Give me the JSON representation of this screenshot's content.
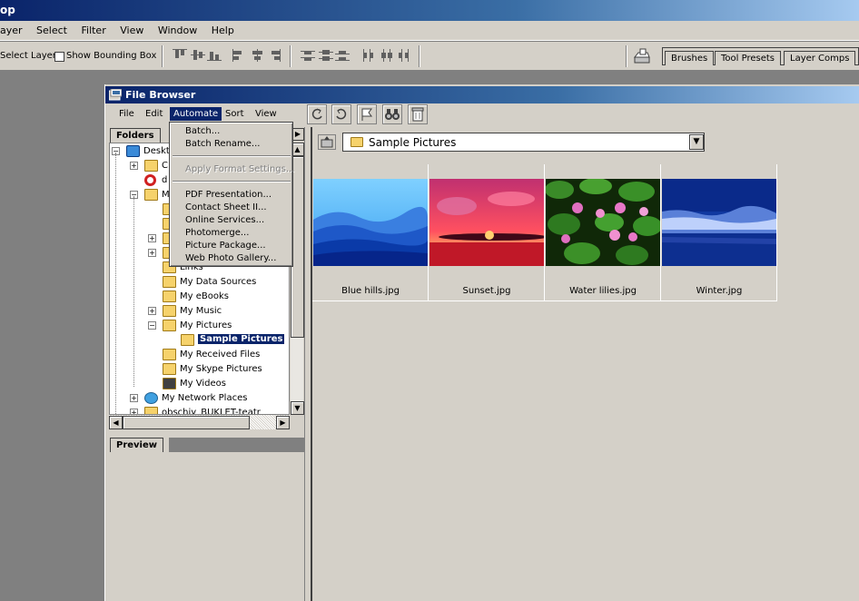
{
  "app": {
    "title": "op"
  },
  "main_menu": [
    "ayer",
    "Select",
    "Filter",
    "View",
    "Window",
    "Help"
  ],
  "options_bar": {
    "auto_select_label": "Select Layer",
    "bounding_box_label": "Show Bounding Box"
  },
  "palette_well": {
    "tabs": [
      "Brushes",
      "Tool Presets",
      "Layer Comps"
    ]
  },
  "file_browser": {
    "title": "File Browser",
    "menu": [
      "File",
      "Edit",
      "Automate",
      "Sort",
      "View"
    ],
    "automate_menu": {
      "group1": [
        "Batch...",
        "Batch Rename..."
      ],
      "group2": [
        "Apply Format Settings..."
      ],
      "group3": [
        "PDF Presentation...",
        "Contact Sheet II...",
        "Online Services...",
        "Photomerge...",
        "Picture Package...",
        "Web Photo Gallery..."
      ]
    },
    "folders_tab": "Folders",
    "preview_tab": "Preview",
    "tree": [
      {
        "label": "Deskto",
        "indent": 0,
        "expander": "-"
      },
      {
        "label": "C",
        "indent": 1,
        "expander": "+"
      },
      {
        "label": "d",
        "indent": 1,
        "expander": ""
      },
      {
        "label": "M",
        "indent": 1,
        "expander": "-"
      },
      {
        "label": "",
        "indent": 2,
        "expander": ""
      },
      {
        "label": "",
        "indent": 2,
        "expander": ""
      },
      {
        "label": "",
        "indent": 2,
        "expander": "+"
      },
      {
        "label": "",
        "indent": 2,
        "expander": "+"
      },
      {
        "label": "Links",
        "indent": 2,
        "expander": ""
      },
      {
        "label": "My Data Sources",
        "indent": 2,
        "expander": ""
      },
      {
        "label": "My eBooks",
        "indent": 2,
        "expander": ""
      },
      {
        "label": "My Music",
        "indent": 2,
        "expander": "+"
      },
      {
        "label": "My Pictures",
        "indent": 2,
        "expander": "-"
      },
      {
        "label": "Sample Pictures",
        "indent": 3,
        "expander": "",
        "selected": true
      },
      {
        "label": "My Received Files",
        "indent": 2,
        "expander": ""
      },
      {
        "label": "My Skype Pictures",
        "indent": 2,
        "expander": ""
      },
      {
        "label": "My Videos",
        "indent": 2,
        "expander": ""
      },
      {
        "label": "My Network Places",
        "indent": 1,
        "expander": "+"
      },
      {
        "label": "obschiy_BUKLET-teatr",
        "indent": 1,
        "expander": "+"
      }
    ],
    "location": "Sample Pictures",
    "thumbnails": [
      {
        "name": "Blue hills.jpg"
      },
      {
        "name": "Sunset.jpg"
      },
      {
        "name": "Water lilies.jpg"
      },
      {
        "name": "Winter.jpg"
      }
    ]
  },
  "colors": {
    "selection": "#0a246a",
    "chrome": "#d4d0c8",
    "title_gradient_start": "#0a246a"
  }
}
